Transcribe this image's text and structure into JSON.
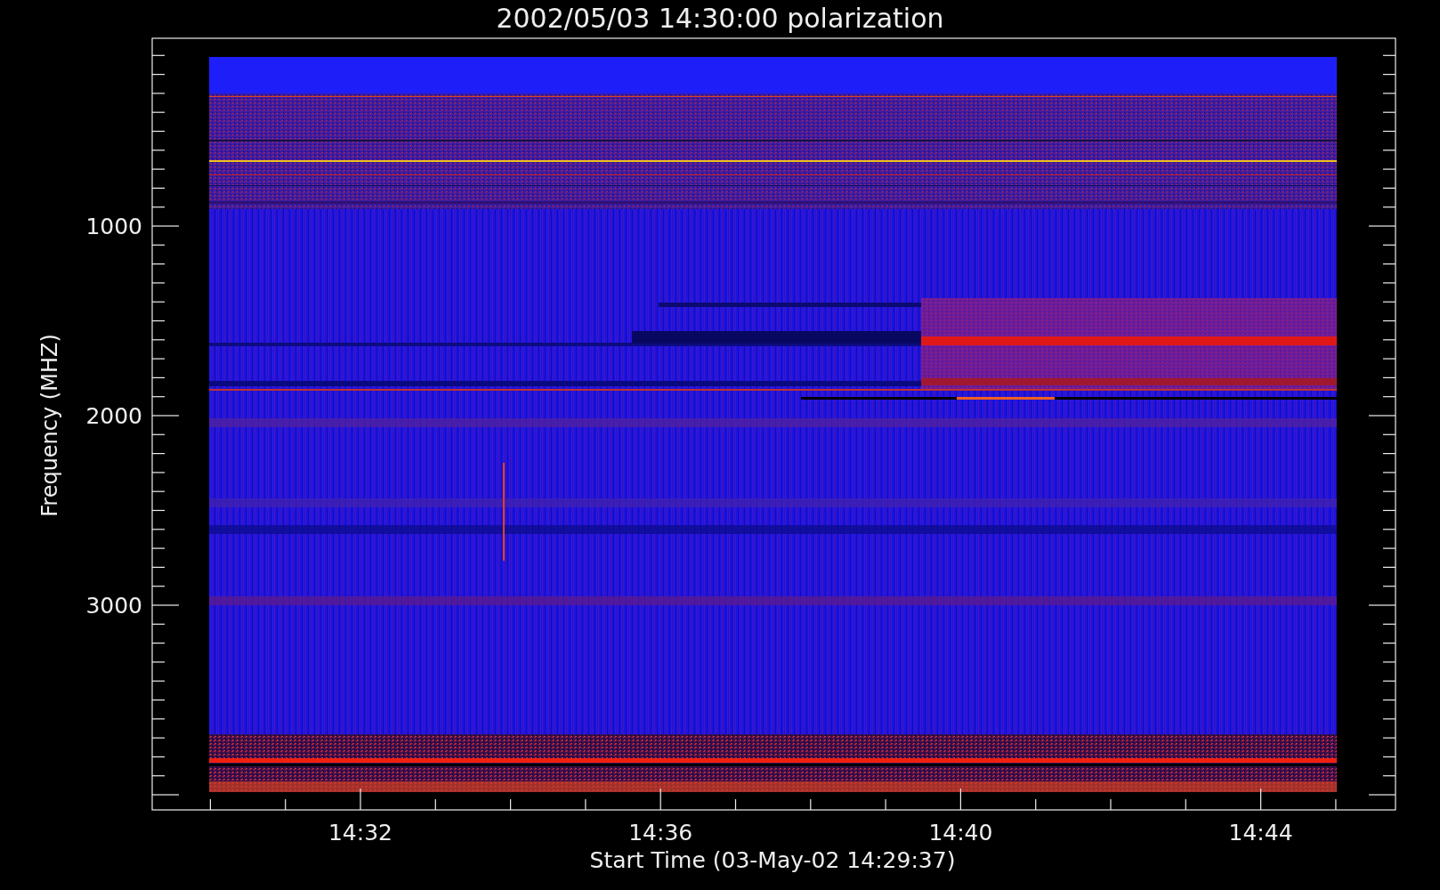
{
  "title": "2002/05/03 14:30:00 polarization",
  "y_axis": {
    "label": "Frequency (MHZ)",
    "ticks": [
      "1000",
      "2000",
      "3000"
    ]
  },
  "x_axis": {
    "label": "Start Time (03-May-02 14:29:37)",
    "ticks": [
      "14:32",
      "14:36",
      "14:40",
      "14:44"
    ]
  }
}
